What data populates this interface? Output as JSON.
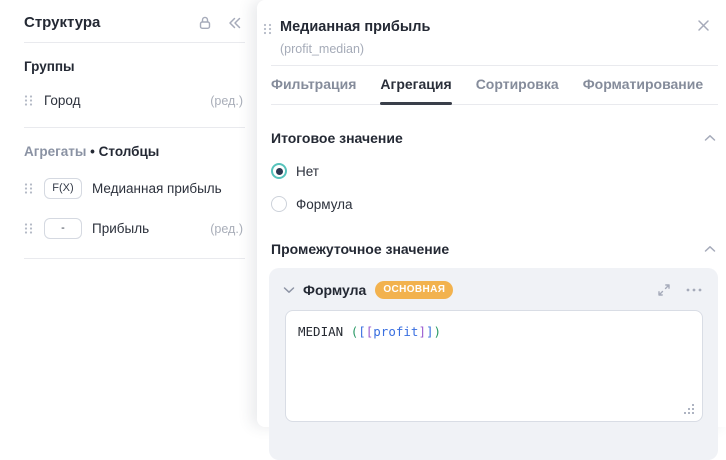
{
  "sidebar": {
    "title": "Структура",
    "groups": {
      "title": "Группы",
      "items": [
        {
          "label": "Город",
          "edit": "(ред.)"
        }
      ]
    },
    "aggregates": {
      "title_part1": "Агрегаты",
      "dot": "•",
      "title_part2": "Столбцы",
      "items": [
        {
          "badge": "F(X)",
          "label": "Медианная прибыль",
          "edit": ""
        },
        {
          "badge": "-",
          "label": "Прибыль",
          "edit": "(ред.)"
        }
      ]
    }
  },
  "panel": {
    "title": "Медианная прибыль",
    "subtitle": "(profit_median)",
    "tabs": [
      {
        "label": "Фильтрация"
      },
      {
        "label": "Агрегация"
      },
      {
        "label": "Сортировка"
      },
      {
        "label": "Форматирование"
      }
    ],
    "active_tab": "Агрегация",
    "total": {
      "title": "Итоговое значение",
      "option_none": {
        "label": "Нет",
        "selected": true
      },
      "option_formula": {
        "label": "Формула",
        "selected": false
      }
    },
    "intermediate": {
      "title": "Промежуточное значение",
      "card": {
        "title": "Формула",
        "badge": "ОСНОВНАЯ",
        "formula": "MEDIAN ([[profit]])",
        "tokens": [
          {
            "text": "MEDIAN ",
            "style": "color:#272b33"
          },
          {
            "text": "(",
            "style": "color:#2b9a66"
          },
          {
            "text": "[",
            "style": "color:#3a6fe0"
          },
          {
            "text": "[",
            "style": "color:#9a5cd0"
          },
          {
            "text": "profit",
            "style": "color:#3a6fe0"
          },
          {
            "text": "]",
            "style": "color:#9a5cd0"
          },
          {
            "text": "]",
            "style": "color:#3a6fe0"
          },
          {
            "text": ")",
            "style": "color:#2b9a66"
          }
        ]
      }
    }
  },
  "colors": {
    "accent_teal": "#57c3bc",
    "radio_dot": "#2c3850",
    "badge_orange": "#f2b24e",
    "text_primary": "#242934",
    "text_muted": "#868d9c",
    "text_faint": "#a5abb8",
    "divider": "#e9eaee",
    "card_bg": "#f0f2f6"
  },
  "icons": {
    "lock": "padlock-outline",
    "collapse_sidebar": "double-chevron-left",
    "drag_handle": "six-dots-grip",
    "close": "x-mark",
    "section_collapse": "chevron-up",
    "card_collapse": "chevron-down",
    "fullscreen": "expand-diagonal-arrows",
    "more": "horizontal-ellipsis",
    "resize": "corner-grip-dots"
  }
}
